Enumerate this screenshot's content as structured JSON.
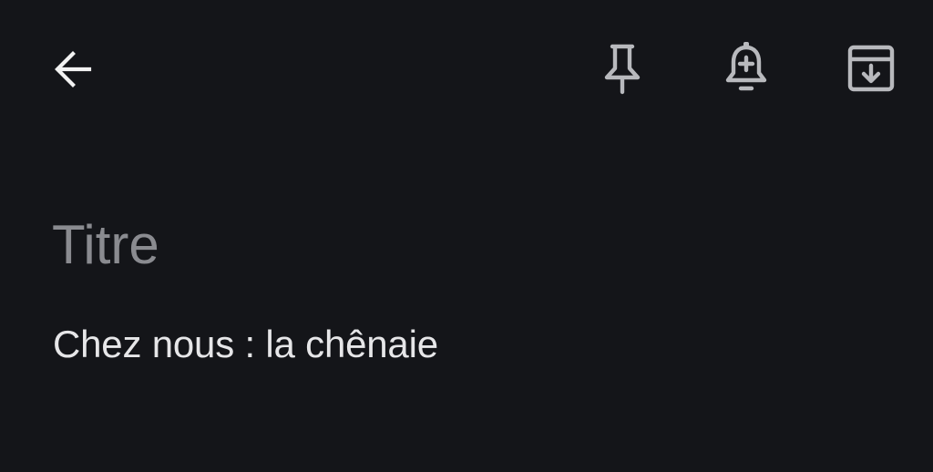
{
  "toolbar": {
    "back_icon": "arrow-left-icon",
    "pin_icon": "pin-icon",
    "reminder_icon": "bell-plus-icon",
    "archive_icon": "archive-icon"
  },
  "note": {
    "title_placeholder": "Titre",
    "title_value": "",
    "body": "Chez nous : la chênaie"
  },
  "colors": {
    "background": "#141519",
    "icon": "#b8b9bd",
    "placeholder": "#8a8b90",
    "text": "#e6e6e8"
  }
}
